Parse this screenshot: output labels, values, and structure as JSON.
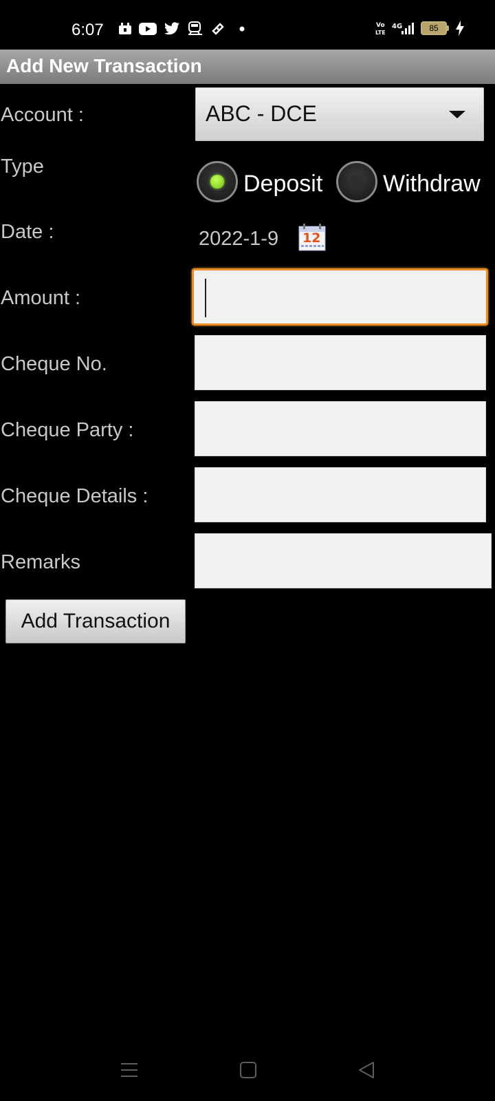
{
  "status_bar": {
    "time": "6:07",
    "battery_level": "85",
    "left_icons": [
      "notification-icon",
      "youtube-icon",
      "twitter-icon",
      "train-icon",
      "ticket-icon",
      "dot-icon"
    ],
    "right_icons": [
      "volte-icon",
      "signal-4g-icon",
      "battery-icon",
      "charging-icon"
    ]
  },
  "title_bar": {
    "title": "Add New Transaction"
  },
  "form": {
    "account": {
      "label": "Account :",
      "value": "ABC - DCE"
    },
    "type": {
      "label": "Type",
      "options": [
        {
          "label": "Deposit",
          "selected": true
        },
        {
          "label": "Withdraw",
          "selected": false
        }
      ]
    },
    "date": {
      "label": "Date :",
      "value": "2022-1-9",
      "icon": "calendar-icon"
    },
    "amount": {
      "label": "Amount :",
      "value": ""
    },
    "cheque_no": {
      "label": "Cheque No.",
      "value": ""
    },
    "cheque_party": {
      "label": "Cheque Party :",
      "value": ""
    },
    "cheque_details": {
      "label": "Cheque Details :",
      "value": ""
    },
    "remarks": {
      "label": "Remarks",
      "value": ""
    },
    "submit_label": "Add Transaction"
  },
  "nav_bar": {
    "icons": [
      "menu-icon",
      "home-icon",
      "back-icon"
    ]
  },
  "colors": {
    "background": "#000000",
    "title_bar": "#8f8f8f",
    "focus_border": "#ee8d1f",
    "radio_selected": "#7ed321"
  }
}
